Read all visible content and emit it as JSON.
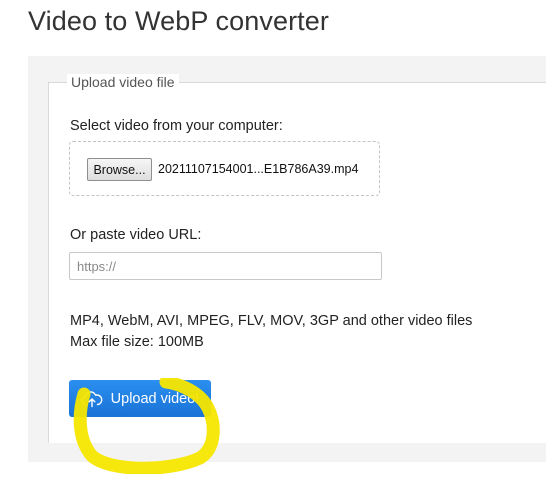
{
  "page": {
    "title": "Video to WebP converter"
  },
  "upload_form": {
    "legend": "Upload video file",
    "file_section_label": "Select video from your computer:",
    "browse_label": "Browse...",
    "selected_file": "20211107154001...E1B786A39.mp4",
    "url_section_label": "Or paste video URL:",
    "url_value": "",
    "url_placeholder": "https://",
    "formats_text": "MP4, WebM, AVI, MPEG, FLV, MOV, 3GP and other video files",
    "max_size_text": "Max file size: 100MB",
    "upload_button_label": "Upload video!",
    "upload_icon": "cloud-upload-icon"
  },
  "colors": {
    "upload_button": "#1a73d6",
    "highlight_annotation": "#f5e600",
    "panel_background": "#f3f3f3"
  }
}
